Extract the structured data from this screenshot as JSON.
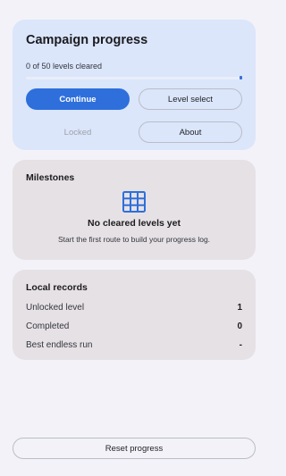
{
  "campaign": {
    "title": "Campaign progress",
    "progress_text": "0 of 50 levels cleared",
    "progress_fraction": 0,
    "buttons": {
      "continue": "Continue",
      "level_select": "Level select",
      "locked": "Locked",
      "about": "About"
    }
  },
  "milestones": {
    "title": "Milestones",
    "icon": "grid-icon",
    "empty_title": "No cleared levels yet",
    "empty_subtitle": "Start the first route to build your progress log."
  },
  "records": {
    "title": "Local records",
    "rows": [
      {
        "label": "Unlocked level",
        "value": "1"
      },
      {
        "label": "Completed",
        "value": "0"
      },
      {
        "label": "Best endless run",
        "value": "-"
      }
    ]
  },
  "footer": {
    "reset_label": "Reset progress"
  },
  "colors": {
    "accent": "#2e6fdc",
    "campaign_card": "#dbe6fb",
    "section_card": "#e6e1e5",
    "background": "#f3f2f8"
  }
}
